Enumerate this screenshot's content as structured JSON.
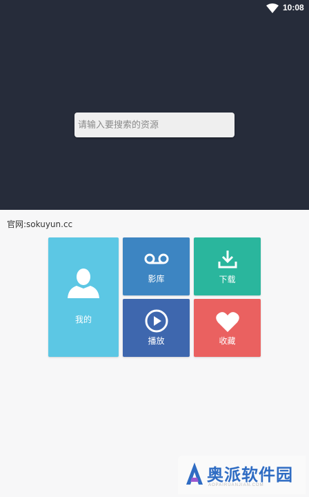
{
  "status_bar": {
    "time": "10:08",
    "wifi_icon": "wifi-icon"
  },
  "search": {
    "placeholder": "请输入要搜索的资源",
    "value": ""
  },
  "site": {
    "label": "官网:sokuyun.cc"
  },
  "tiles": {
    "me": {
      "label": "我的",
      "icon": "person-icon",
      "color": "#5cc7e4"
    },
    "library": {
      "label": "影库",
      "icon": "voicemail-icon",
      "color": "#3d85c2"
    },
    "download": {
      "label": "下载",
      "icon": "download-icon",
      "color": "#2ab69d"
    },
    "play": {
      "label": "播放",
      "icon": "play-circle-icon",
      "color": "#3e67ae"
    },
    "favorites": {
      "label": "收藏",
      "icon": "heart-icon",
      "color": "#ea6160"
    }
  },
  "watermark": {
    "text": "奥派软件园",
    "sub": "AOPAIRUANJIAN.COM",
    "icon": "logo-icon",
    "color": "#2f6cc3"
  },
  "colors": {
    "header_bg": "#262c3a",
    "page_bg": "#f7f7f8"
  }
}
